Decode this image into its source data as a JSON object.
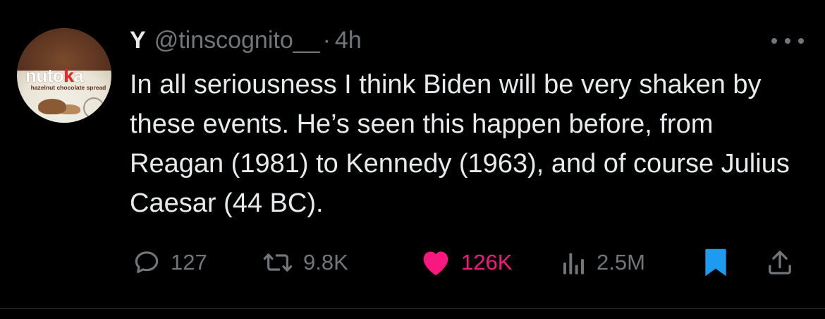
{
  "tweet": {
    "author": {
      "display_name": "Y",
      "handle": "@tinscognito__",
      "avatar": {
        "brand": "nutoka",
        "subtitle": "hazelnut chocolate spread"
      }
    },
    "separator": "·",
    "time": "4h",
    "text": "In all seriousness I think Biden will be very shaken by these events. He’s seen this happen before, from Reagan (1981) to Kennedy (1963), and of course Julius Caesar (44 BC).",
    "stats": {
      "replies": "127",
      "retweets": "9.8K",
      "likes": "126K",
      "views": "2.5M"
    },
    "state": {
      "liked": true,
      "bookmarked": true
    }
  },
  "icons": {
    "reply": "speech-bubble-icon",
    "retweet": "retweet-arrows-icon",
    "like": "heart-icon",
    "views": "bar-chart-icon",
    "bookmark": "bookmark-icon",
    "share": "share-upload-icon",
    "more": "more-horizontal-icon"
  },
  "colors": {
    "background": "#000000",
    "text_primary": "#e7e9ea",
    "text_secondary": "#71767b",
    "like_active": "#f91880",
    "bookmark_active": "#1d9bf0"
  }
}
